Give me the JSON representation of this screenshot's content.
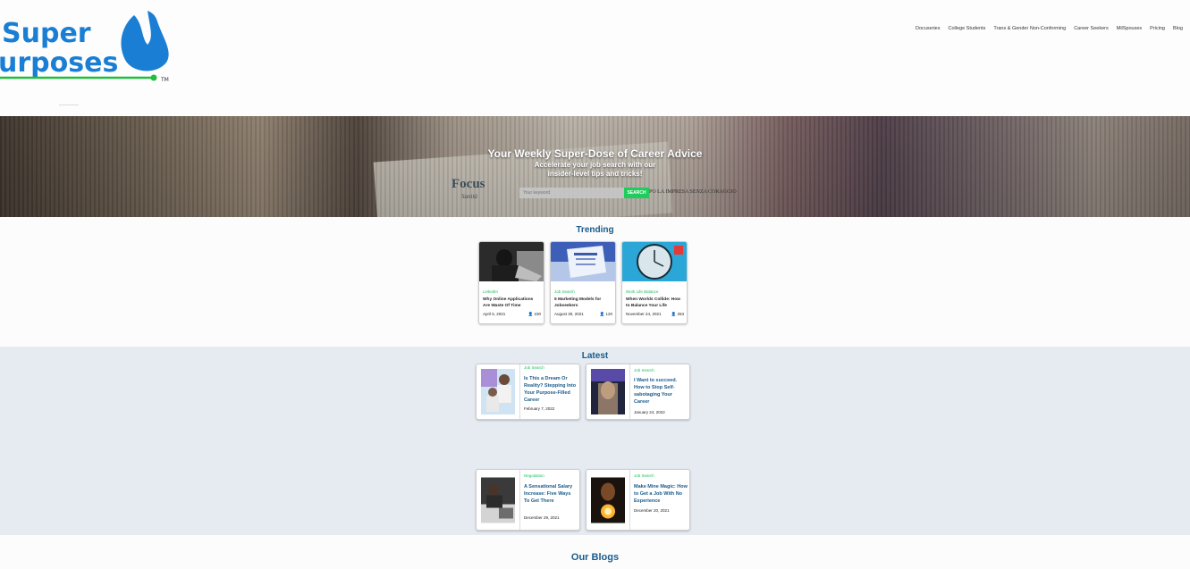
{
  "logo": {
    "line1": "Super",
    "line2": "urposes",
    "tm": "TM"
  },
  "nav": [
    "Docuseries",
    "College Students",
    "Trans & Gender Non-Conforming",
    "Career Seekers",
    "MilSpouses",
    "Pricing",
    "Blog"
  ],
  "hero": {
    "title": "Your Weekly Super-Dose of Career Advice",
    "subtitle_line1": "Accelerate your job search with our",
    "subtitle_line2": "insider-level tips and tricks!",
    "background_text_focus": "Focus",
    "background_text_sub": "Sanità",
    "background_text_right": "PO LA IMPRESA SENZA CORAGGIO",
    "search_placeholder": "Your keyword",
    "search_button": "SEARCH"
  },
  "trending": {
    "title": "Trending",
    "cards": [
      {
        "category": "LinkedIn",
        "title": "Why Online Applications Are Waste Of Time",
        "date": "April 5, 2021",
        "views": "230"
      },
      {
        "category": "Job Search",
        "title": "5 Marketing Models for Jobseekers",
        "date": "August 30, 2021",
        "views": "120"
      },
      {
        "category": "Work Life Balance",
        "title": "When Worlds Collide: How to Balance Your Life",
        "date": "November 24, 2021",
        "views": "253"
      }
    ]
  },
  "latest": {
    "title": "Latest",
    "cards": [
      {
        "category": "Job Search",
        "title": "Is This a Dream Or Reality? Stepping Into Your Purpose-Filled Career",
        "date": "February 7, 2022"
      },
      {
        "category": "Job Search",
        "title": "I Want to succeed. How to Stop Self-sabotaging Your Career",
        "date": "January 24, 2022"
      },
      {
        "category": "Negotiation",
        "title": "A Sensational Salary Increase: Five Ways To Get There",
        "date": "December 29, 2021"
      },
      {
        "category": "Job Search",
        "title": "Make Mine Magic: How to Get a Job With No Experience",
        "date": "December 20, 2021"
      }
    ]
  },
  "blogs": {
    "title": "Our Blogs"
  },
  "colors": {
    "brand_blue": "#1a7fd4",
    "heading_blue": "#1a5b8a",
    "green": "#1fcc5c",
    "latest_bg": "#e6ebf1"
  },
  "icons": [
    "logo-drop",
    "user-icon"
  ]
}
